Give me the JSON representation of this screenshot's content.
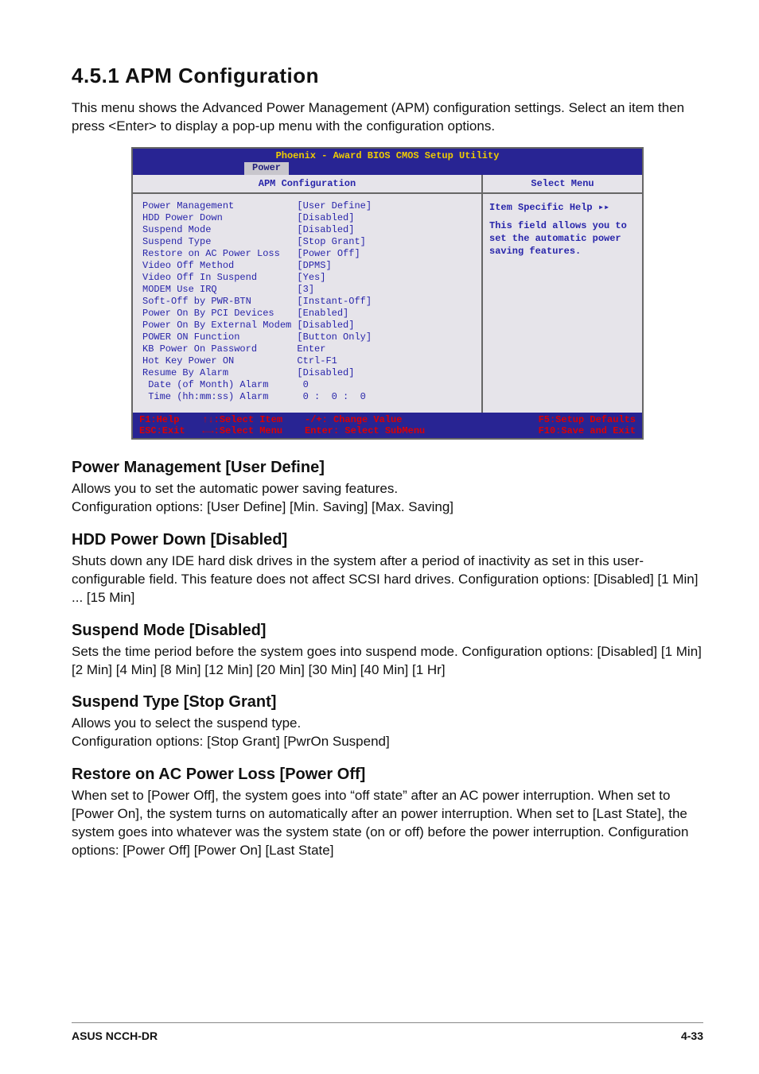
{
  "section": {
    "number_title": "4.5.1   APM Configuration",
    "intro": "This menu shows the Advanced Power Management (APM) configuration settings. Select an item then press <Enter> to display a pop-up menu with the configuration options."
  },
  "bios": {
    "title": "Phoenix - Award BIOS CMOS Setup Utility",
    "tab": "Power",
    "main_header": "APM Configuration",
    "help_header": "Select Menu",
    "help_line1": "Item Specific Help ▸▸",
    "help_body": "This field allows you to set the automatic power saving features.",
    "items": [
      {
        "label": "Power Management",
        "value": "[User Define]"
      },
      {
        "label": "HDD Power Down",
        "value": "[Disabled]"
      },
      {
        "label": "Suspend Mode",
        "value": "[Disabled]"
      },
      {
        "label": "Suspend Type",
        "value": "[Stop Grant]"
      },
      {
        "label": "Restore on AC Power Loss",
        "value": "[Power Off]"
      },
      {
        "label": "Video Off Method",
        "value": "[DPMS]"
      },
      {
        "label": "Video Off In Suspend",
        "value": "[Yes]"
      },
      {
        "label": "MODEM Use IRQ",
        "value": "[3]"
      },
      {
        "label": "Soft-Off by PWR-BTN",
        "value": "[Instant-Off]"
      },
      {
        "label": "Power On By PCI Devices",
        "value": "[Enabled]"
      },
      {
        "label": "Power On By External Modem",
        "value": "[Disabled]"
      },
      {
        "label": "POWER ON Function",
        "value": "[Button Only]"
      },
      {
        "label": "KB Power On Password",
        "value": "Enter"
      },
      {
        "label": "Hot Key Power ON",
        "value": "Ctrl-F1"
      },
      {
        "label": "Resume By Alarm",
        "value": "[Disabled]"
      },
      {
        "label": " Date (of Month) Alarm",
        "value": " 0"
      },
      {
        "label": " Time (hh:mm:ss) Alarm",
        "value": " 0 :  0 :  0"
      }
    ],
    "footer": {
      "left": "F1:Help    ↑↓:Select Item\nESC:Exit   ←→:Select Menu",
      "mid": "-/+: Change Value\nEnter: Select SubMenu",
      "right": "F5:Setup Defaults\nF10:Save and Exit"
    }
  },
  "subs": {
    "s1": {
      "h": "Power Management [User Define]",
      "p": "Allows you to set the automatic power saving features.\nConfiguration options: [User Define] [Min. Saving] [Max. Saving]"
    },
    "s2": {
      "h": "HDD Power Down [Disabled]",
      "p": "Shuts down any IDE hard disk drives in the system after a period of inactivity as set in this user-configurable field. This feature does not affect SCSI hard drives. Configuration options: [Disabled] [1 Min] ... [15 Min]"
    },
    "s3": {
      "h": "Suspend Mode [Disabled]",
      "p": "Sets the time period before the system goes into suspend mode. Configuration options: [Disabled] [1 Min] [2 Min] [4 Min] [8 Min] [12 Min] [20 Min] [30 Min] [40 Min] [1 Hr]"
    },
    "s4": {
      "h": "Suspend Type [Stop Grant]",
      "p": "Allows you to select the suspend type.\nConfiguration options: [Stop Grant] [PwrOn Suspend]"
    },
    "s5": {
      "h": "Restore on AC Power Loss [Power Off]",
      "p": "When set to [Power Off], the system goes into “off state” after an AC power interruption. When set to [Power On], the system turns on automatically after an power interruption. When set to [Last State], the system goes into whatever was the system state (on or off) before the power interruption. Configuration options: [Power Off] [Power On] [Last State]"
    }
  },
  "footer": {
    "left": "ASUS NCCH-DR",
    "right": "4-33"
  }
}
